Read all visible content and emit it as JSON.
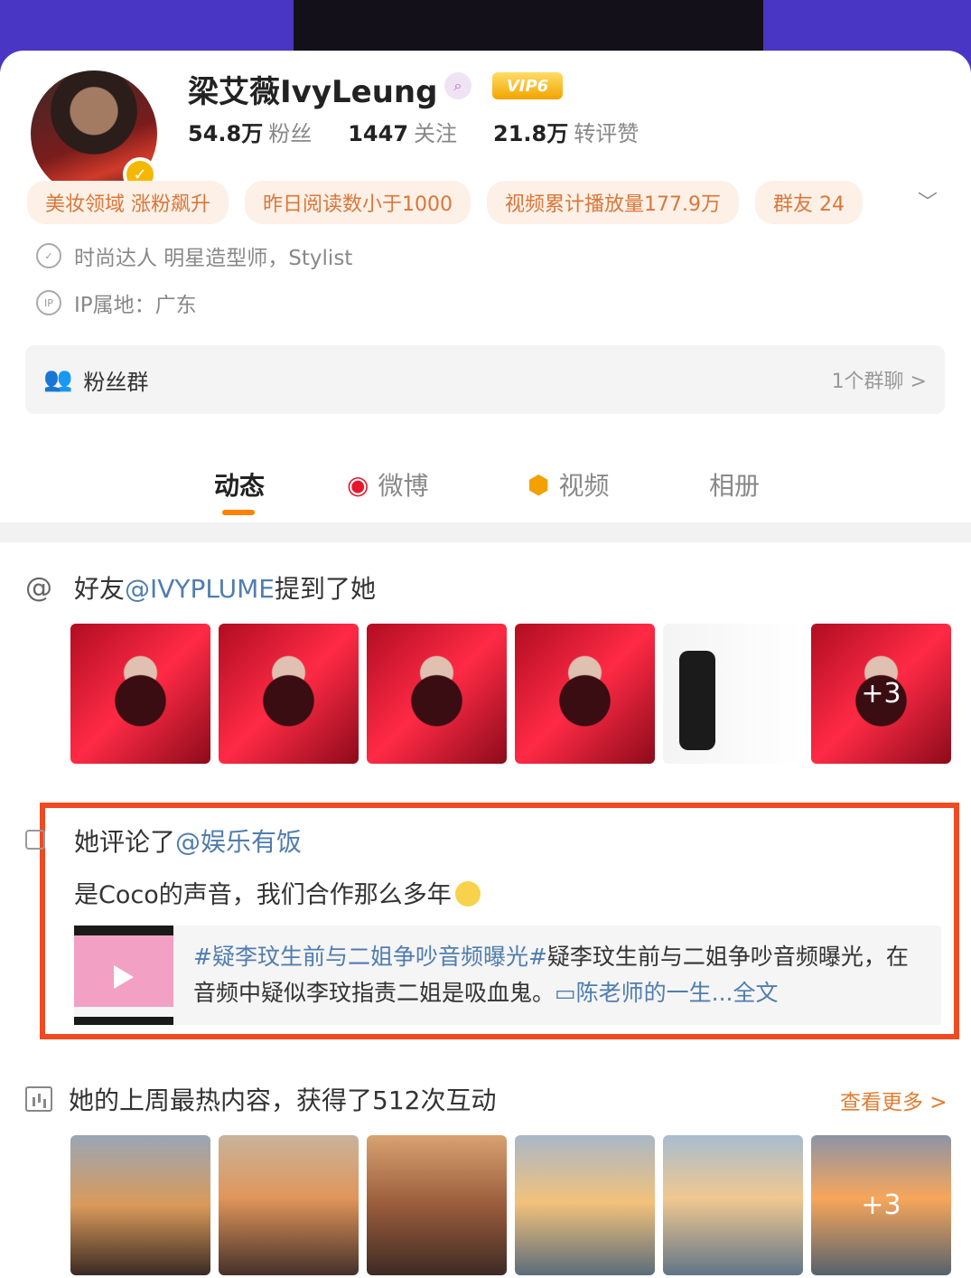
{
  "profile": {
    "name": "梁艾薇IvyLeung",
    "vip_label": "VIP6",
    "stats": [
      {
        "num": "54.8万",
        "label": "粉丝"
      },
      {
        "num": "1447",
        "label": "关注"
      },
      {
        "num": "21.8万",
        "label": "转评赞"
      }
    ],
    "tags": [
      "美妆领域 涨粉飙升",
      "昨日阅读数小于1000",
      "视频累计播放量177.9万",
      "群友 24"
    ],
    "verification": "时尚达人 明星造型师，Stylist",
    "ip_location": "IP属地：广东",
    "ip_icon_text": "IP"
  },
  "fans_group": {
    "label": "粉丝群",
    "count": "1个群聊 >"
  },
  "tabs": [
    "动态",
    "微博",
    "视频",
    "相册"
  ],
  "feed": {
    "mention": {
      "prefix": "好友",
      "user": "@IVYPLUME",
      "suffix": "提到了她",
      "more_count": "+3"
    },
    "comment": {
      "prefix": "她评论了",
      "target": "@娱乐有饭",
      "text": "是Coco的声音，我们合作那么多年",
      "quote_hashtag": "#疑李玟生前与二姐争吵音频曝光#",
      "quote_body": "疑李玟生前与二姐争吵音频曝光，在音频中疑似李玟指责二姐是吸血鬼。",
      "quote_link": "陈老师的一生...",
      "quote_fulltext": "全文"
    },
    "hot": {
      "text": "她的上周最热内容，获得了512次互动",
      "see_more": "查看更多 >",
      "more_count": "+3"
    }
  },
  "colors": {
    "accent": "#ff8200",
    "highlight_border": "#ef4a22",
    "link": "#507daf",
    "tag_text": "#d9773b"
  }
}
